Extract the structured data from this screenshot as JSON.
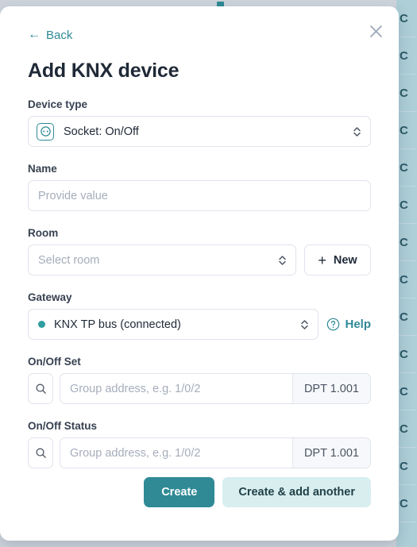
{
  "backdrop": {
    "list_items": [
      "C",
      "C",
      "C",
      "C",
      "C",
      "C",
      "C",
      "C",
      "C",
      "C",
      "C",
      "C",
      "C",
      "C"
    ]
  },
  "modal": {
    "back_label": "Back",
    "back_arrow": "←",
    "title": "Add KNX device",
    "close_icon": "close-icon",
    "device_type": {
      "label": "Device type",
      "value": "Socket: On/Off",
      "icon": "socket-icon"
    },
    "name": {
      "label": "Name",
      "value": "",
      "placeholder": "Provide value"
    },
    "room": {
      "label": "Room",
      "value": "",
      "placeholder": "Select room",
      "new_button_label": "New",
      "plus_glyph": "+"
    },
    "gateway": {
      "label": "Gateway",
      "value": "KNX TP bus (connected)",
      "status_color": "#2f9e9e",
      "help_label": "Help",
      "help_icon": "question-circle-icon"
    },
    "onoff_set": {
      "label": "On/Off Set",
      "value": "",
      "placeholder": "Group address, e.g. 1/0/2",
      "dpt": "DPT 1.001",
      "search_icon": "search-icon"
    },
    "onoff_status": {
      "label": "On/Off Status",
      "value": "",
      "placeholder": "Group address, e.g. 1/0/2",
      "dpt": "DPT 1.001",
      "search_icon": "search-icon"
    },
    "footer": {
      "create_label": "Create",
      "create_add_another_label": "Create & add another"
    }
  },
  "colors": {
    "accent": "#2f8a96",
    "accent_soft": "#d8eeef",
    "text": "#1f2937",
    "placeholder": "#a6adbb",
    "border": "#dfe3ec",
    "backdrop": "#ced4dc"
  }
}
